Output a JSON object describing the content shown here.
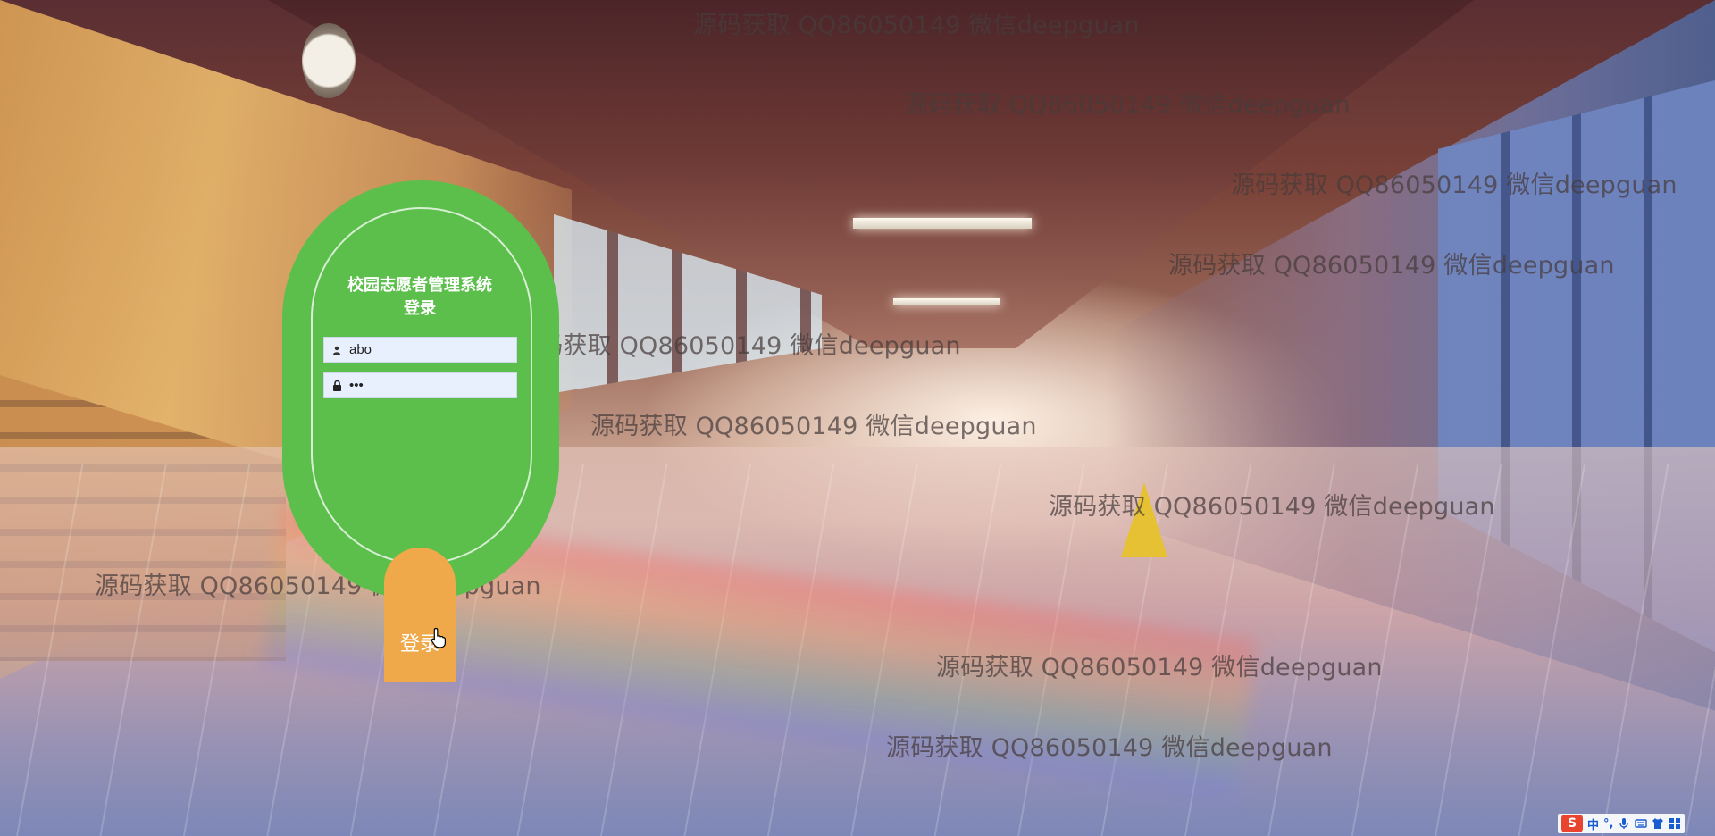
{
  "login": {
    "title": "校园志愿者管理系统登录",
    "username_value": "abo",
    "password_value": "abc",
    "submit_label": "登录"
  },
  "watermarks": {
    "text": "源码获取 QQ86050149 微信deepguan"
  },
  "ime_tray": {
    "logo": "S",
    "mode": "中",
    "punct": "°,",
    "icons": [
      "mic-icon",
      "keyboard-icon",
      "shirt-icon",
      "grid-icon"
    ]
  },
  "colors": {
    "card_green": "#5cbf4c",
    "button_orange": "#f0a94a",
    "input_bg": "#e8f0fe"
  }
}
